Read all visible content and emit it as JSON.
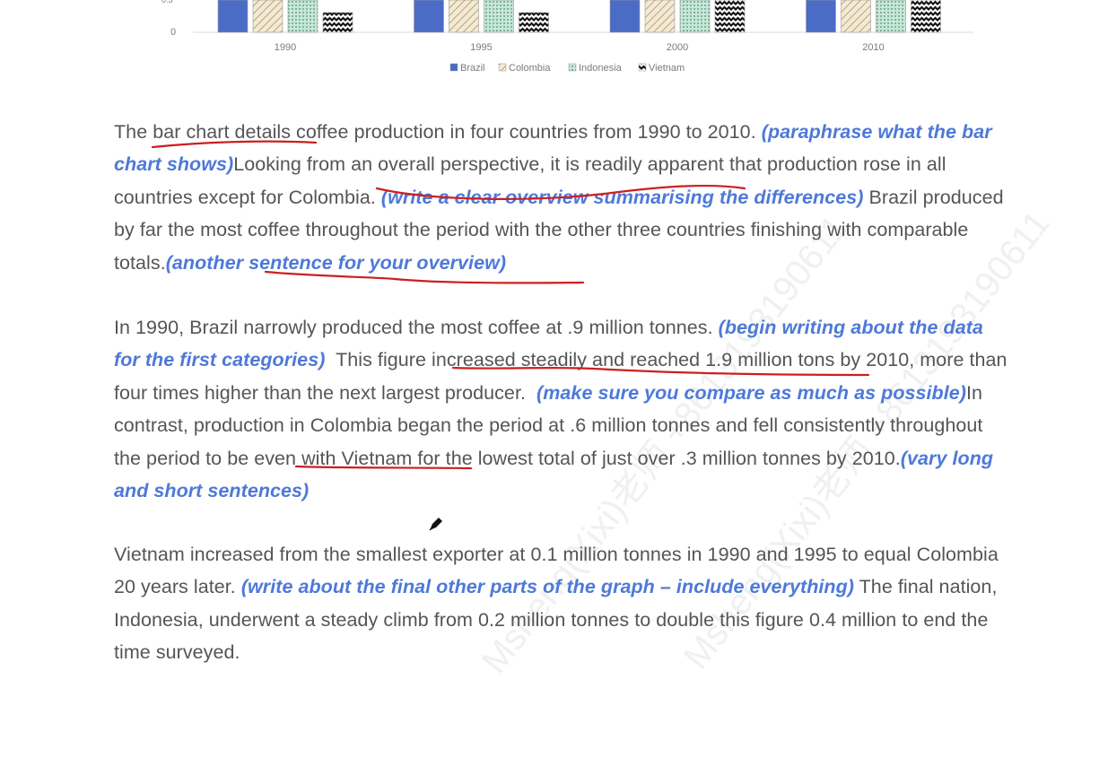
{
  "chart_data": {
    "type": "bar",
    "categories": [
      "1990",
      "1995",
      "2000",
      "2010"
    ],
    "series": [
      {
        "name": "Brazil",
        "color": "#4a6cc7",
        "pattern": "solid"
      },
      {
        "name": "Colombia",
        "color": "#d8c8a0",
        "pattern": "diagonal-hatch"
      },
      {
        "name": "Indonesia",
        "color": "#9fcfb8",
        "pattern": "dots"
      },
      {
        "name": "Vietnam",
        "color": "#222222",
        "pattern": "waves"
      }
    ],
    "visible_ytick": "0",
    "legend_position": "bottom"
  },
  "essay": {
    "p1": {
      "s1": "The bar chart details coffee production in four countries from 1990 to 2010.",
      "n1": "(paraphrase what the bar chart shows)",
      "s2": "Looking from an overall perspective, it is readily apparent that production rose in all countries except for Colombia.",
      "n2": "(write a clear overview summarising the differences)",
      "s3": "Brazil produced by far the most coffee throughout the period with the other three countries finishing with comparable totals.",
      "n3": "(another sentence for your overview)"
    },
    "p2": {
      "s1": "In 1990, Brazil narrowly produced the most coffee at .9 million tonnes.",
      "n1": "(begin writing about the data for the first categories)",
      "s2": "This figure increased steadily and reached 1.9 million tons by 2010, more than four times higher than the next largest producer.",
      "n2": "(make sure you compare as much as possible)",
      "s3": "In contrast, production in Colombia began the period at .6 million tonnes and fell consistently throughout the period to be even with Vietnam for the lowest total of just over .3 million tonnes by 2010.",
      "n3": "(vary long and short sentences)"
    },
    "p3": {
      "s1": "Vietnam increased from the smallest exporter at 0.1 million tonnes in 1990 and 1995 to equal Colombia 20 years later.",
      "n1": "(write about the final other parts of the graph – include everything)",
      "s2": "The final nation, Indonesia, underwent a steady climb from 0.2 million tonnes to double this figure 0.4 million to end the time surveyed."
    }
  },
  "watermark": {
    "text": "Msheng(Xixi)老师 +8613193190611"
  },
  "icons": {
    "cursor": "pen-cursor-icon"
  }
}
